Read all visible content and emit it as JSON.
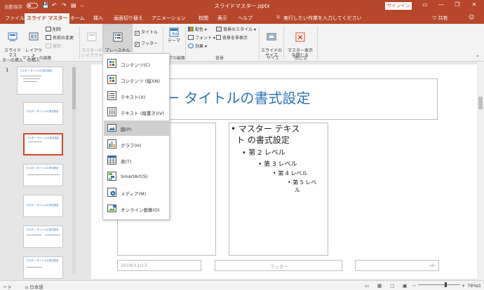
{
  "titlebar": {
    "autosave_label": "自動保存",
    "toggle_state": "オフ",
    "document_title": "スライドマスター.pptx",
    "signin_label": "サインイン",
    "minimize": "—",
    "restore": "❐",
    "maximize": "☐",
    "close": "✕",
    "qa_save": "💾",
    "qa_undo": "↶",
    "qa_redo": "↷",
    "qa_present": "▤",
    "qa_more": "⌵"
  },
  "tabs": [
    {
      "label": "ファイル"
    },
    {
      "label": "スライド マスター"
    },
    {
      "label": "ホーム"
    },
    {
      "label": "挿入"
    },
    {
      "label": "画面切り替え"
    },
    {
      "label": "アニメーション"
    },
    {
      "label": "校閲"
    },
    {
      "label": "表示"
    },
    {
      "label": "ヘルプ"
    }
  ],
  "tellme_placeholder": "実行したい作業を入力してください",
  "share_label": "共有",
  "ribbon": {
    "insert_master": "スライド マス\nターの挿入",
    "insert_layout": "レイアウト\nの挿入",
    "delete": "削除",
    "rename": "名前の変更",
    "preserve": "保存",
    "master_layout": "マスターの\nレイアウト",
    "placeholder_insert": "プレースホルダー\nの挿入",
    "title_check": "タイトル",
    "footer_check": "フッター",
    "theme": "テーマ",
    "colors": "配色",
    "fonts": "フォント",
    "effects": "効果",
    "bg_styles": "背景のスタイル",
    "hide_bg": "背景を非表示",
    "slide_size": "スライドの\nサイズ",
    "close_master": "マスター表示\nを閉じる",
    "group_master_edit": "マスターの編集",
    "group_theme_edit": "プの編集",
    "group_background": "背景",
    "group_size": "サイズ",
    "group_close": "閉じる"
  },
  "menu": [
    {
      "label": "コンテンツ(C)",
      "icon": "content-icon"
    },
    {
      "label": "コンテンツ (縦)(N)",
      "icon": "content-vertical-icon"
    },
    {
      "label": "テキスト(X)",
      "icon": "text-icon"
    },
    {
      "label": "テキスト (縦書き)(V)",
      "icon": "text-vertical-icon"
    },
    {
      "label": "図(P)",
      "icon": "picture-icon"
    },
    {
      "label": "グラフ(H)",
      "icon": "chart-icon"
    },
    {
      "label": "表(T)",
      "icon": "table-icon"
    },
    {
      "label": "SmartArt(S)",
      "icon": "smartart-icon"
    },
    {
      "label": "メディア(M)",
      "icon": "media-icon"
    },
    {
      "label": "オンライン画像(O)",
      "icon": "online-picture-icon"
    }
  ],
  "thumbnails": [
    {
      "number": "1",
      "title": "マスター タイトルの書式設定"
    },
    {
      "number": "",
      "title": "マスター タイトルの書式設定"
    },
    {
      "number": "",
      "title": "マスター タイトルの書式設定"
    },
    {
      "number": "",
      "title": "マスター タイトルの書式設定"
    },
    {
      "number": "",
      "title": "マスター タイトルの書式設定"
    },
    {
      "number": "",
      "title": "マスター タイトルの書式設定"
    },
    {
      "number": "",
      "title": "マスター タイトルの書式設定"
    }
  ],
  "slide": {
    "title": "ー タイトルの書式設定",
    "body_lines": [
      "• マスター テキス",
      "ト の書式設定",
      "• 第 2 レベル",
      "• 第 3 レベル",
      "• 第 4 レベル",
      "• 第 5 レベ",
      "ル"
    ],
    "footer_date": "2018/12/13",
    "footer_center": "フッター",
    "footer_number": "‹#›"
  },
  "statusbar": {
    "view_label": "ート",
    "language": "日本語",
    "zoom": "78%",
    "zoom_minus": "−",
    "zoom_plus": "+",
    "fit": "⊡"
  },
  "colors": {
    "accent": "#b7472a",
    "title_blue": "#2e75b6",
    "selected_thumb": "#d24726"
  }
}
